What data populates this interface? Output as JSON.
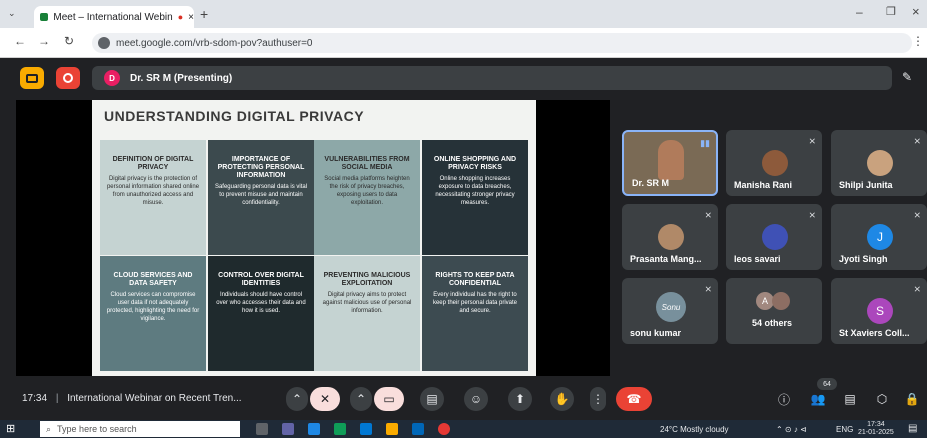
{
  "browser": {
    "tab_title": "Meet – International Webin",
    "url": "meet.google.com/vrb-sdom-pov?authuser=0"
  },
  "meet": {
    "presenter_label": "Dr. SR M (Presenting)",
    "presenter_initial": "D"
  },
  "slide": {
    "title": "UNDERSTANDING DIGITAL PRIVACY",
    "cells": [
      {
        "heading": "DEFINITION OF DIGITAL PRIVACY",
        "body": "Digital privacy is the protection of personal information shared online from unauthorized access and misuse."
      },
      {
        "heading": "IMPORTANCE OF PROTECTING PERSONAL INFORMATION",
        "body": "Safeguarding personal data is vital to prevent misuse and maintain confidentiality."
      },
      {
        "heading": "VULNERABILITIES FROM SOCIAL MEDIA",
        "body": "Social media platforms heighten the risk of privacy breaches, exposing users to data exploitation."
      },
      {
        "heading": "ONLINE SHOPPING AND PRIVACY RISKS",
        "body": "Online shopping increases exposure to data breaches, necessitating stronger privacy measures."
      },
      {
        "heading": "CLOUD SERVICES AND DATA SAFETY",
        "body": "Cloud services can compromise user data if not adequately protected, highlighting the need for vigilance."
      },
      {
        "heading": "CONTROL OVER DIGITAL IDENTITIES",
        "body": "Individuals should have control over who accesses their data and how it is used."
      },
      {
        "heading": "PREVENTING MALICIOUS EXPLOITATION",
        "body": "Digital privacy aims to protect against malicious use of personal information."
      },
      {
        "heading": "RIGHTS TO KEEP DATA CONFIDENTIAL",
        "body": "Every individual has the right to keep their personal data private and secure."
      }
    ]
  },
  "participants": [
    {
      "name": "Dr. SR M",
      "initial": ""
    },
    {
      "name": "Manisha Rani",
      "initial": ""
    },
    {
      "name": "Shilpi Junita",
      "initial": ""
    },
    {
      "name": "Prasanta Mang...",
      "initial": ""
    },
    {
      "name": "leos savari",
      "initial": ""
    },
    {
      "name": "Jyoti Singh",
      "initial": "J"
    },
    {
      "name": "sonu kumar",
      "initial": "Sonu"
    },
    {
      "name": "54 others",
      "initial": "A"
    },
    {
      "name": "St Xaviers Coll...",
      "initial": "S"
    }
  ],
  "bottom": {
    "time": "17:34",
    "meeting_title": "International Webinar on Recent Tren...",
    "people_count": "64"
  },
  "taskbar": {
    "search_placeholder": "Type here to search",
    "weather": "24°C  Mostly cloudy",
    "lang": "ENG",
    "clock_time": "17:34",
    "clock_date": "21-01-2025"
  },
  "colors": {
    "cell_colors": [
      "#c5d3d2",
      "#3c4a4e",
      "#8da8a8",
      "#263238",
      "#5e7b80",
      "#1f2a2d",
      "#c5d3d2",
      "#3d4b51"
    ],
    "end_call": "#ea4335",
    "cam_off_bg": "#f9dedc"
  }
}
